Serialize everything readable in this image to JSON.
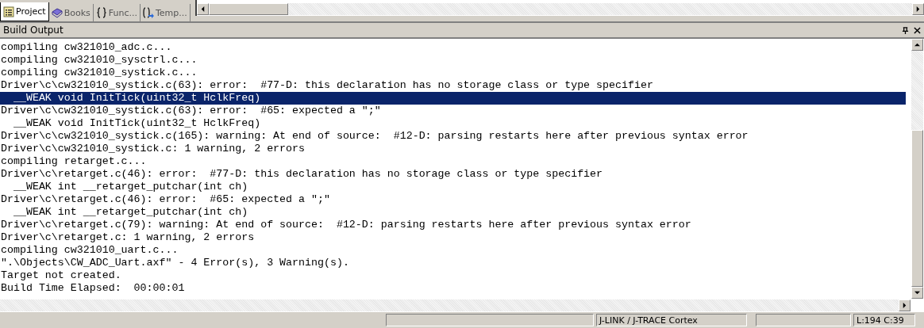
{
  "tabs": [
    {
      "label": "Project",
      "selected": true,
      "kind": "project"
    },
    {
      "label": "Books",
      "selected": false,
      "kind": "books"
    },
    {
      "label": "Func...",
      "selected": false,
      "kind": "functions"
    },
    {
      "label": "Temp...",
      "selected": false,
      "kind": "templates"
    }
  ],
  "panel": {
    "title": "Build Output"
  },
  "lines": [
    {
      "text": "compiling cw321010_adc.c...",
      "selected": false
    },
    {
      "text": "compiling cw321010_sysctrl.c...",
      "selected": false
    },
    {
      "text": "compiling cw321010_systick.c...",
      "selected": false
    },
    {
      "text": "Driver\\c\\cw321010_systick.c(63): error:  #77-D: this declaration has no storage class or type specifier",
      "selected": false
    },
    {
      "text": "  __WEAK void InitTick(uint32_t HclkFreq)",
      "selected": true
    },
    {
      "text": "Driver\\c\\cw321010_systick.c(63): error:  #65: expected a \";\"",
      "selected": false
    },
    {
      "text": "  __WEAK void InitTick(uint32_t HclkFreq)",
      "selected": false
    },
    {
      "text": "Driver\\c\\cw321010_systick.c(165): warning: At end of source:  #12-D: parsing restarts here after previous syntax error",
      "selected": false
    },
    {
      "text": "Driver\\c\\cw321010_systick.c: 1 warning, 2 errors",
      "selected": false
    },
    {
      "text": "compiling retarget.c...",
      "selected": false
    },
    {
      "text": "Driver\\c\\retarget.c(46): error:  #77-D: this declaration has no storage class or type specifier",
      "selected": false
    },
    {
      "text": "  __WEAK int __retarget_putchar(int ch)",
      "selected": false
    },
    {
      "text": "Driver\\c\\retarget.c(46): error:  #65: expected a \";\"",
      "selected": false
    },
    {
      "text": "  __WEAK int __retarget_putchar(int ch)",
      "selected": false
    },
    {
      "text": "Driver\\c\\retarget.c(79): warning: At end of source:  #12-D: parsing restarts here after previous syntax error",
      "selected": false
    },
    {
      "text": "Driver\\c\\retarget.c: 1 warning, 2 errors",
      "selected": false
    },
    {
      "text": "compiling cw321010_uart.c...",
      "selected": false
    },
    {
      "text": "\".\\Objects\\CW_ADC_Uart.axf\" - 4 Error(s), 3 Warning(s).",
      "selected": false
    },
    {
      "text": "Target not created.",
      "selected": false
    },
    {
      "text": "Build Time Elapsed:  00:00:01",
      "selected": false
    }
  ],
  "status_bar": {
    "target": "J-LINK / J-TRACE Cortex",
    "position": "L:194 C:39"
  }
}
